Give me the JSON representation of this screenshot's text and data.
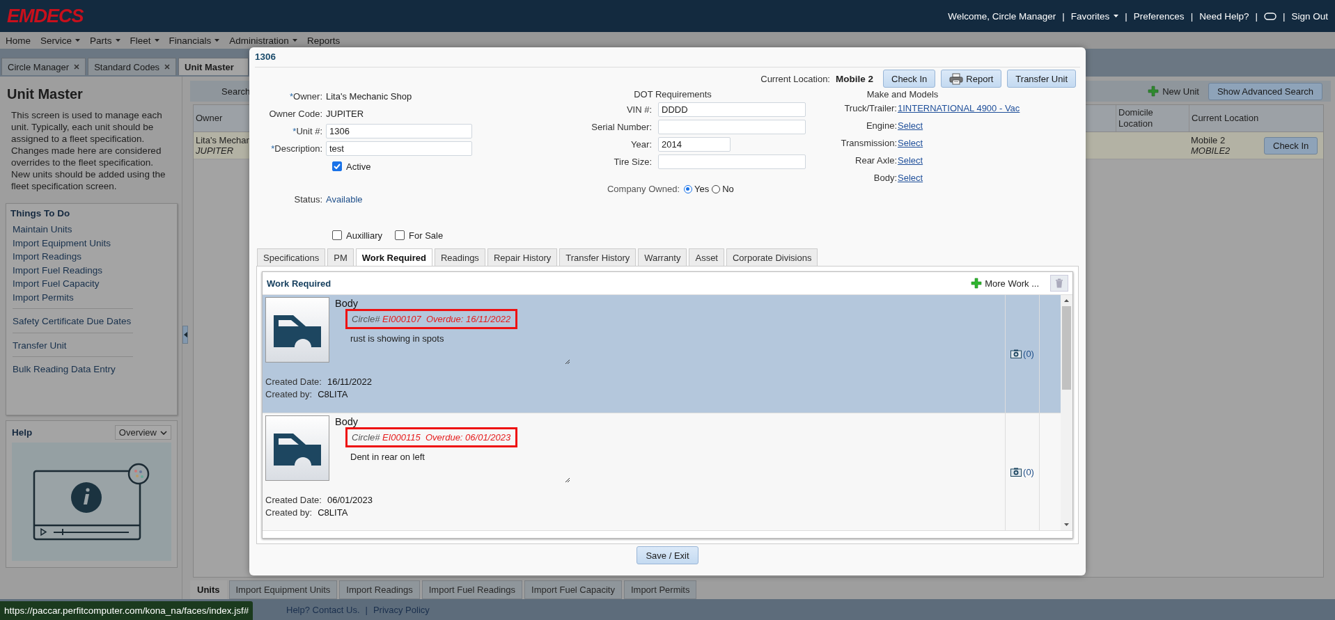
{
  "header": {
    "logo": "EMDECS",
    "items": [
      {
        "kind": "text",
        "label": "Welcome, Circle Manager"
      },
      {
        "kind": "sep",
        "label": "|"
      },
      {
        "kind": "menu",
        "label": "Favorites"
      },
      {
        "kind": "sep",
        "label": "|"
      },
      {
        "kind": "link",
        "label": "Preferences"
      },
      {
        "kind": "sep",
        "label": "|"
      },
      {
        "kind": "link",
        "label": "Need Help?"
      },
      {
        "kind": "sep",
        "label": "|"
      },
      {
        "kind": "icon"
      },
      {
        "kind": "sep",
        "label": "|"
      },
      {
        "kind": "link",
        "label": "Sign Out"
      }
    ]
  },
  "menu": [
    {
      "label": "Home",
      "dropdown": false
    },
    {
      "label": "Service",
      "dropdown": true
    },
    {
      "label": "Parts",
      "dropdown": true
    },
    {
      "label": "Fleet",
      "dropdown": true
    },
    {
      "label": "Financials",
      "dropdown": true
    },
    {
      "label": "Administration",
      "dropdown": true
    },
    {
      "label": "Reports",
      "dropdown": false
    }
  ],
  "page_tabs": [
    {
      "label": "Circle Manager",
      "closable": true,
      "selected": false
    },
    {
      "label": "Standard Codes",
      "closable": true,
      "selected": false
    },
    {
      "label": "Unit Master",
      "closable": false,
      "selected": true
    }
  ],
  "sidebar": {
    "title": "Unit Master",
    "description": "This screen is used to manage each unit. Typically, each unit should be assigned to a fleet specification. Changes made here are considered overrides to the fleet specification. New units should be added using the fleet specification screen.",
    "things_to_do": {
      "title": "Things To Do",
      "groups": [
        [
          "Maintain Units",
          "Import Equipment Units",
          "Import Readings",
          "Import Fuel Readings",
          "Import Fuel Capacity",
          "Import Permits"
        ],
        [
          "Safety Certificate Due Dates"
        ],
        [
          "Transfer Unit"
        ],
        [
          "Bulk Reading Data Entry"
        ]
      ]
    },
    "help": {
      "title": "Help",
      "dropdown": "Overview"
    }
  },
  "main": {
    "search_label": "Search",
    "new_unit": "New Unit",
    "advanced_search": "Show Advanced Search",
    "columns": [
      "Owner",
      "Domicile Location",
      "Current Location"
    ],
    "rows": [
      {
        "owner_name": "Lita's Mechan",
        "owner_code": "JUPITER",
        "current_location": "Mobile 2",
        "current_location_code": "MOBILE2",
        "action": "Check In",
        "selected": true
      }
    ],
    "bottom_tabs": [
      {
        "label": "Units",
        "selected": true
      },
      {
        "label": "Import Equipment Units",
        "selected": false
      },
      {
        "label": "Import Readings",
        "selected": false
      },
      {
        "label": "Import Fuel Readings",
        "selected": false
      },
      {
        "label": "Import Fuel Capacity",
        "selected": false
      },
      {
        "label": "Import Permits",
        "selected": false
      }
    ]
  },
  "footer": {
    "links": [
      "Help? Contact Us.",
      "Privacy Policy"
    ],
    "separator": "|"
  },
  "status_url": "https://paccar.perfitcomputer.com/kona_na/faces/index.jsf#",
  "modal": {
    "title": "1306",
    "current_location_label": "Current Location:",
    "current_location": "Mobile 2",
    "buttons": [
      {
        "label": "Check In",
        "kind": "plain"
      },
      {
        "label": "Report",
        "kind": "print"
      },
      {
        "label": "Transfer Unit",
        "kind": "plain"
      }
    ],
    "owner_fields": [
      {
        "required_mark": "*",
        "label": "Owner:",
        "kind": "text",
        "value": "Lita's Mechanic Shop"
      },
      {
        "label": "Owner Code:",
        "kind": "text",
        "value": "JUPITER"
      },
      {
        "required_mark": "*",
        "label": "Unit #:",
        "kind": "input",
        "value": "1306"
      },
      {
        "required_mark": "*",
        "label": "Description:",
        "kind": "input",
        "value": "test"
      }
    ],
    "active": {
      "label": "Active",
      "checked": true
    },
    "status": {
      "label": "Status:",
      "value": "Available"
    },
    "flags": [
      {
        "label": "Auxilliary",
        "checked": false
      },
      {
        "label": "For Sale",
        "checked": false
      }
    ],
    "dot": {
      "title": "DOT Requirements",
      "fields": [
        {
          "label": "VIN #:",
          "kind": "text",
          "value": "DDDD"
        },
        {
          "label": "Serial Number:",
          "kind": "text"
        },
        {
          "label": "Year:",
          "kind": "number",
          "value": "2014"
        },
        {
          "label": "Tire Size:",
          "kind": "text"
        }
      ],
      "company_owned": {
        "label": "Company Owned:",
        "options": [
          {
            "label": "Yes",
            "selected": true
          },
          {
            "label": "No",
            "selected": false
          }
        ]
      }
    },
    "make_models": {
      "title": "Make and Models",
      "items": [
        {
          "label": "Truck/Trailer:",
          "link": "1INTERNATIONAL 4900 - Vac"
        },
        {
          "label": "Engine:",
          "link": "Select"
        },
        {
          "label": "Transmission:",
          "link": "Select"
        },
        {
          "label": "Rear Axle:",
          "link": "Select"
        },
        {
          "label": "Body:",
          "link": "Select"
        }
      ]
    },
    "tabs": [
      {
        "label": "Specifications",
        "selected": false
      },
      {
        "label": "PM",
        "selected": false
      },
      {
        "label": "Work Required",
        "selected": true
      },
      {
        "label": "Readings",
        "selected": false
      },
      {
        "label": "Repair History",
        "selected": false
      },
      {
        "label": "Transfer History",
        "selected": false
      },
      {
        "label": "Warranty",
        "selected": false
      },
      {
        "label": "Asset",
        "selected": false
      },
      {
        "label": "Corporate Divisions",
        "selected": false
      }
    ],
    "work": {
      "title": "Work Required",
      "add_label": "More Work ...",
      "items": [
        {
          "category": "Body",
          "circle_label": "Circle#",
          "circle_number": "EI000107",
          "overdue": "Overdue: 16/11/2022",
          "highlighted": true,
          "note": "rust is showing in spots",
          "created_date_label": "Created Date:",
          "created_date": "16/11/2022",
          "created_by_label": "Created by:",
          "created_by": "C8LITA",
          "photos": "(0)",
          "selected": true
        },
        {
          "category": "Body",
          "circle_label": "Circle#",
          "circle_number": "EI000115",
          "overdue": "Overdue: 06/01/2023",
          "highlighted": true,
          "note": "Dent in rear on left",
          "created_date_label": "Created Date:",
          "created_date": "06/01/2023",
          "created_by_label": "Created by:",
          "created_by": "C8LITA",
          "photos": "(0)",
          "selected": false
        }
      ]
    },
    "save_button": "Save / Exit"
  }
}
